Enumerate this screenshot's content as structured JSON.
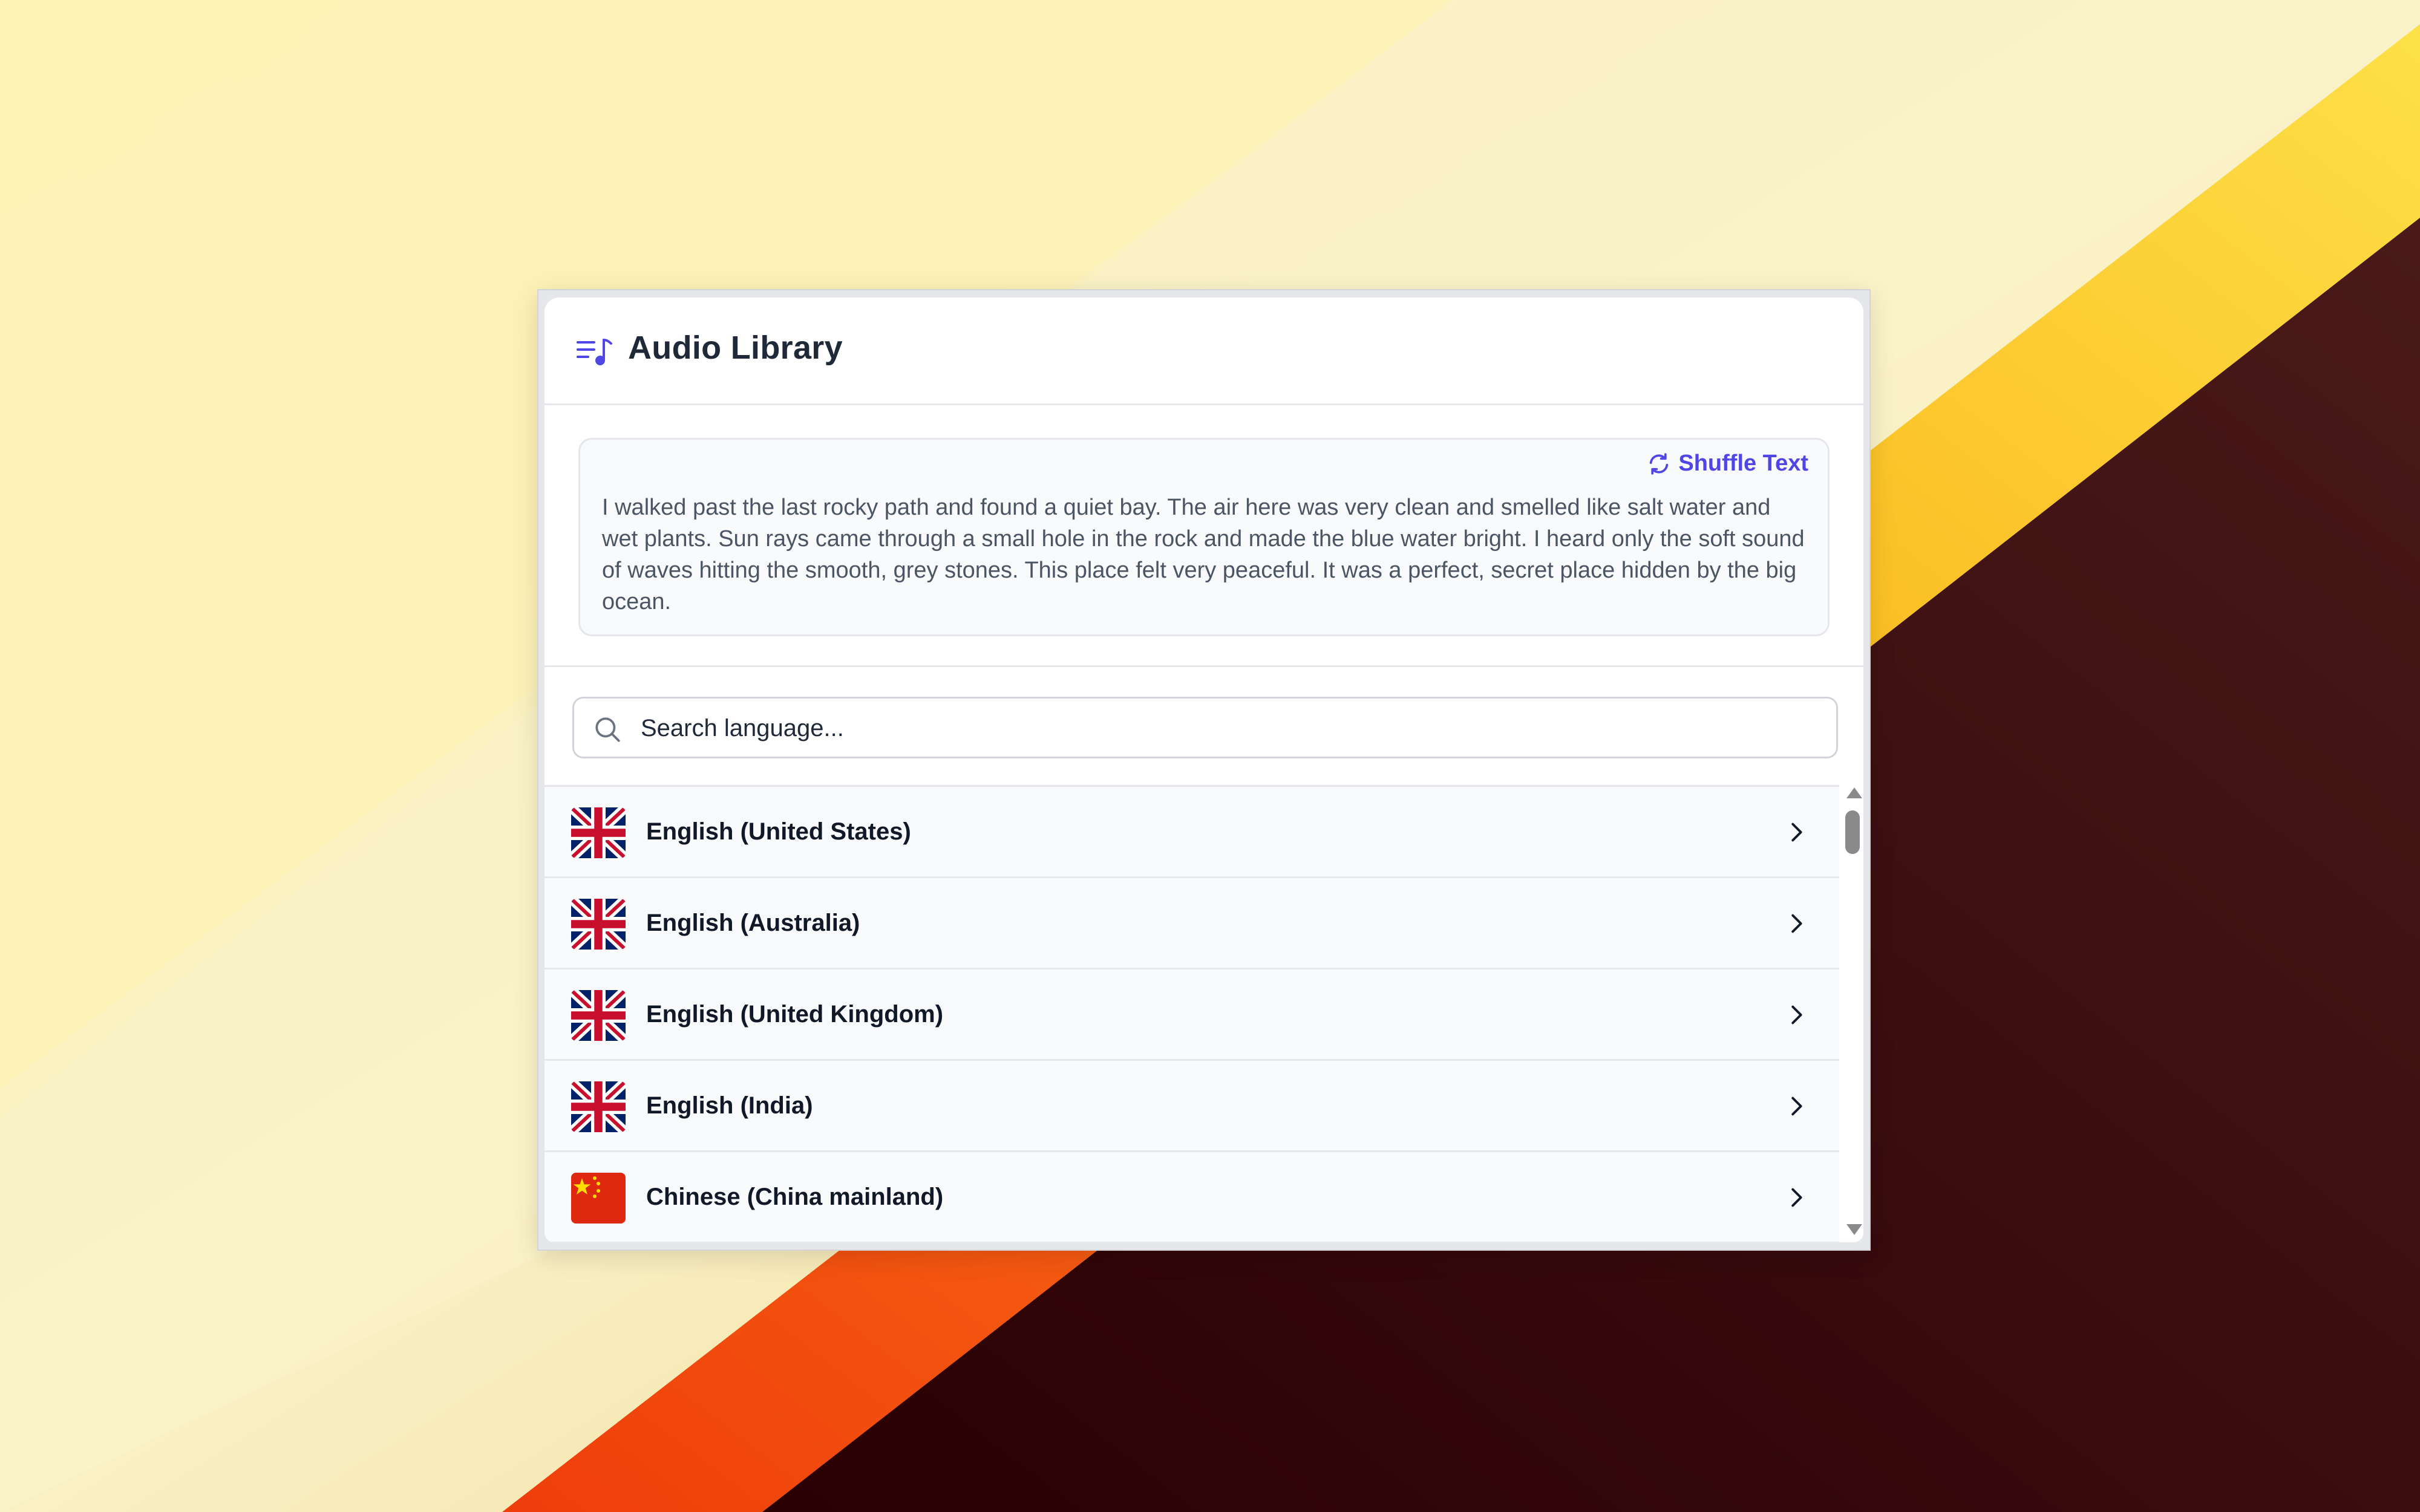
{
  "window": {
    "title": "Audio Library",
    "logo_icon": "playlist-music-icon"
  },
  "text_card": {
    "shuffle_label": "Shuffle Text",
    "shuffle_icon": "refresh-icon",
    "passage": "I walked past the last rocky path and found a quiet bay. The air here was very clean and smelled like salt water and wet plants. Sun rays came through a small hole in the rock and made the blue water bright. I heard only the soft sound of waves hitting the smooth, grey stones. This place felt very peaceful. It was a perfect, secret place hidden by the big ocean."
  },
  "search": {
    "placeholder": "Search language...",
    "value": "",
    "icon": "search-icon"
  },
  "languages": [
    {
      "label": "English (United States)",
      "flag": "uk-flag"
    },
    {
      "label": "English (Australia)",
      "flag": "uk-flag"
    },
    {
      "label": "English (United Kingdom)",
      "flag": "uk-flag"
    },
    {
      "label": "English (India)",
      "flag": "uk-flag"
    },
    {
      "label": "Chinese (China mainland)",
      "flag": "china-flag"
    }
  ],
  "colors": {
    "accent": "#4f46e5",
    "title": "#1f2937",
    "row_bg": "#f8fafc",
    "border": "#e5e7eb"
  }
}
